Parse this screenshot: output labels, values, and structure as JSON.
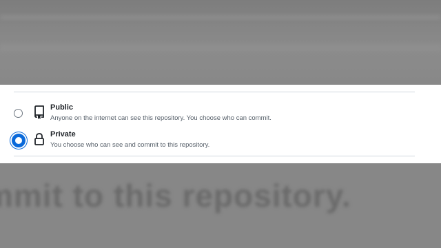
{
  "visibility_options": [
    {
      "title": "Public",
      "description": "Anyone on the internet can see this repository. You choose who can commit.",
      "icon": "repo-icon",
      "selected": false
    },
    {
      "title": "Private",
      "description": "You choose who can see and commit to this repository.",
      "icon": "lock-icon",
      "selected": true
    }
  ],
  "background_text": "mmit to this repository.",
  "colors": {
    "accent": "#0969da",
    "title_text": "#1f2328",
    "muted_text": "#57606a",
    "divider": "#d0d7de",
    "overlay": "#8a8a8a"
  }
}
